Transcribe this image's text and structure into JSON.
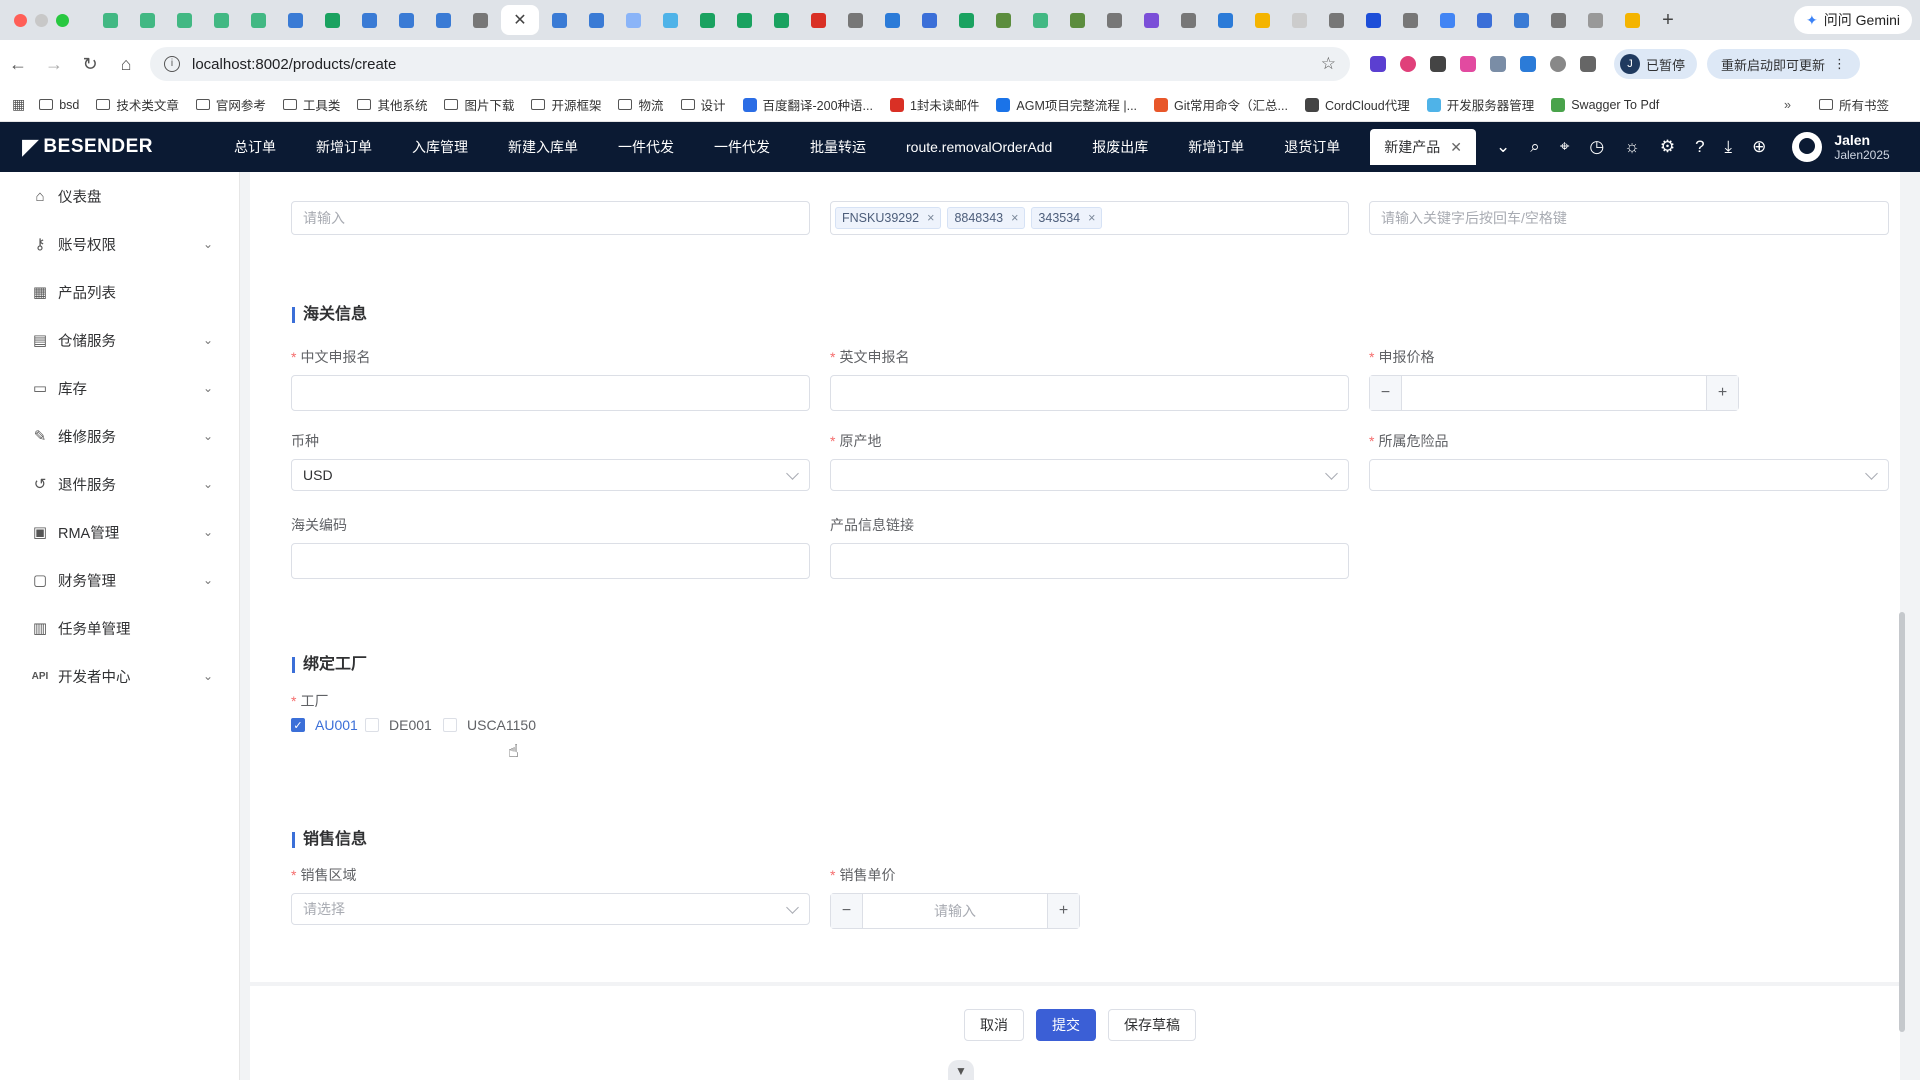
{
  "browser": {
    "active_tab_close": "✕",
    "new_tab": "+",
    "gemini": "问问 Gemini",
    "url": "localhost:8002/products/create",
    "profile_initial": "J",
    "profile_status": "已暂停",
    "restart": "重新启动即可更新",
    "bookmarks": [
      {
        "label": "bsd",
        "kind": "folder"
      },
      {
        "label": "技术类文章",
        "kind": "folder"
      },
      {
        "label": "官网参考",
        "kind": "folder"
      },
      {
        "label": "工具类",
        "kind": "folder"
      },
      {
        "label": "其他系统",
        "kind": "folder"
      },
      {
        "label": "图片下载",
        "kind": "folder"
      },
      {
        "label": "开源框架",
        "kind": "folder"
      },
      {
        "label": "物流",
        "kind": "folder"
      },
      {
        "label": "设计",
        "kind": "folder"
      },
      {
        "label": "百度翻译-200种语...",
        "kind": "fav",
        "color": "#2b6de5"
      },
      {
        "label": "1封未读邮件",
        "kind": "fav",
        "color": "#d93025"
      },
      {
        "label": "AGM项目完整流程 |...",
        "kind": "fav",
        "color": "#1a73e8"
      },
      {
        "label": "Git常用命令（汇总...",
        "kind": "fav",
        "color": "#e8572a"
      },
      {
        "label": "CordCloud代理",
        "kind": "fav",
        "color": "#444444"
      },
      {
        "label": "开发服务器管理",
        "kind": "fav",
        "color": "#4fb3e8"
      },
      {
        "label": "Swagger To Pdf",
        "kind": "fav",
        "color": "#49a34b"
      }
    ],
    "all_bookmarks": "所有书签",
    "more": "»"
  },
  "app": {
    "brand": "BESENDER",
    "nav": [
      "总订单",
      "新增订单",
      "入库管理",
      "新建入库单",
      "一件代发",
      "一件代发",
      "批量转运",
      "route.removalOrderAdd",
      "报废出库",
      "新增订单",
      "退货订单"
    ],
    "active_tab": "新建产品",
    "active_tab_close": "✕",
    "user_name": "Jalen",
    "user_id": "Jalen2025"
  },
  "sidebar": [
    {
      "label": "仪表盘",
      "icon": "home-icon",
      "glyph": "⌂",
      "expandable": false
    },
    {
      "label": "账号权限",
      "icon": "key-icon",
      "glyph": "⚷",
      "expandable": true
    },
    {
      "label": "产品列表",
      "icon": "product-icon",
      "glyph": "▦",
      "expandable": false
    },
    {
      "label": "仓储服务",
      "icon": "warehouse-icon",
      "glyph": "▤",
      "expandable": true
    },
    {
      "label": "库存",
      "icon": "inventory-icon",
      "glyph": "▭",
      "expandable": true
    },
    {
      "label": "维修服务",
      "icon": "wrench-icon",
      "glyph": "✎",
      "expandable": true
    },
    {
      "label": "退件服务",
      "icon": "return-icon",
      "glyph": "↺",
      "expandable": true
    },
    {
      "label": "RMA管理",
      "icon": "lock-icon",
      "glyph": "▣",
      "expandable": true
    },
    {
      "label": "财务管理",
      "icon": "finance-icon",
      "glyph": "▢",
      "expandable": true
    },
    {
      "label": "任务单管理",
      "icon": "task-icon",
      "glyph": "▥",
      "expandable": false
    },
    {
      "label": "开发者中心",
      "icon": "api-icon",
      "glyph": "API",
      "expandable": true
    }
  ],
  "form": {
    "barcode_placeholder": "请输入",
    "fnsku_tags": [
      "FNSKU39292",
      "8848343",
      "343534"
    ],
    "other_barcode_placeholder": "请输入关键字后按回车/空格键",
    "customs_section": "海关信息",
    "cn_name_label": "中文申报名",
    "en_name_label": "英文申报名",
    "price_label": "申报价格",
    "currency_label": "币种",
    "currency_value": "USD",
    "origin_label": "原产地",
    "hazard_label": "所属危险品",
    "hs_label": "海关编码",
    "link_label": "产品信息链接",
    "factory_section": "绑定工厂",
    "factory_label": "工厂",
    "factories": [
      {
        "label": "AU001",
        "checked": true
      },
      {
        "label": "DE001",
        "checked": false
      },
      {
        "label": "USCA1150",
        "checked": false
      }
    ],
    "sales_section": "销售信息",
    "region_label": "销售区域",
    "region_placeholder": "请选择",
    "unit_price_label": "销售单价",
    "unit_price_placeholder": "请输入",
    "minus": "−",
    "plus": "+"
  },
  "actions": {
    "cancel": "取消",
    "submit": "提交",
    "draft": "保存草稿"
  }
}
